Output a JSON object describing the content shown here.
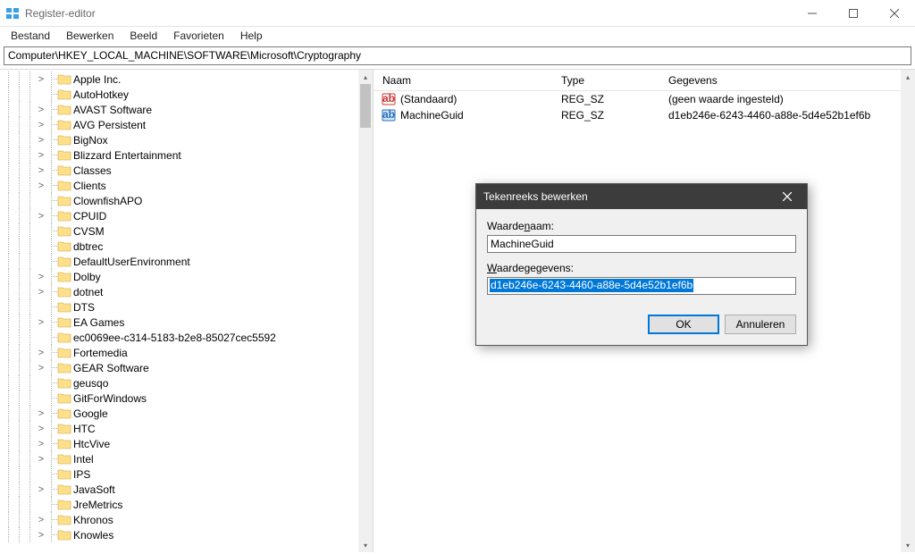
{
  "title": "Register-editor",
  "menu": {
    "bestand": "Bestand",
    "bewerken": "Bewerken",
    "beeld": "Beeld",
    "favorieten": "Favorieten",
    "help": "Help"
  },
  "address": "Computer\\HKEY_LOCAL_MACHINE\\SOFTWARE\\Microsoft\\Cryptography",
  "tree": [
    {
      "label": "Apple Inc.",
      "expand": ">"
    },
    {
      "label": "AutoHotkey",
      "expand": ""
    },
    {
      "label": "AVAST Software",
      "expand": ">"
    },
    {
      "label": "AVG Persistent",
      "expand": ">"
    },
    {
      "label": "BigNox",
      "expand": ">"
    },
    {
      "label": "Blizzard Entertainment",
      "expand": ">"
    },
    {
      "label": "Classes",
      "expand": ">"
    },
    {
      "label": "Clients",
      "expand": ">"
    },
    {
      "label": "ClownfishAPO",
      "expand": ""
    },
    {
      "label": "CPUID",
      "expand": ">"
    },
    {
      "label": "CVSM",
      "expand": ""
    },
    {
      "label": "dbtrec",
      "expand": ""
    },
    {
      "label": "DefaultUserEnvironment",
      "expand": ""
    },
    {
      "label": "Dolby",
      "expand": ">"
    },
    {
      "label": "dotnet",
      "expand": ">"
    },
    {
      "label": "DTS",
      "expand": ""
    },
    {
      "label": "EA Games",
      "expand": ">"
    },
    {
      "label": "ec0069ee-c314-5183-b2e8-85027cec5592",
      "expand": ""
    },
    {
      "label": "Fortemedia",
      "expand": ">"
    },
    {
      "label": "GEAR Software",
      "expand": ">"
    },
    {
      "label": "geusqo",
      "expand": ""
    },
    {
      "label": "GitForWindows",
      "expand": ""
    },
    {
      "label": "Google",
      "expand": ">"
    },
    {
      "label": "HTC",
      "expand": ">"
    },
    {
      "label": "HtcVive",
      "expand": ">"
    },
    {
      "label": "Intel",
      "expand": ">"
    },
    {
      "label": "IPS",
      "expand": ""
    },
    {
      "label": "JavaSoft",
      "expand": ">"
    },
    {
      "label": "JreMetrics",
      "expand": ""
    },
    {
      "label": "Khronos",
      "expand": ">"
    },
    {
      "label": "Knowles",
      "expand": ">"
    }
  ],
  "values": {
    "headers": {
      "naam": "Naam",
      "type": "Type",
      "gegevens": "Gegevens"
    },
    "rows": [
      {
        "icon": "ab-red",
        "name": "(Standaard)",
        "type": "REG_SZ",
        "data": "(geen waarde ingesteld)"
      },
      {
        "icon": "ab-blue",
        "name": "MachineGuid",
        "type": "REG_SZ",
        "data": "d1eb246e-6243-4460-a88e-5d4e52b1ef6b"
      }
    ]
  },
  "dialog": {
    "title": "Tekenreeks bewerken",
    "name_label_pre": "Waarde",
    "name_label_ul": "n",
    "name_label_post": "aam:",
    "name_value": "MachineGuid",
    "data_label_ul": "W",
    "data_label_post": "aardegegevens:",
    "data_value": "d1eb246e-6243-4460-a88e-5d4e52b1ef6b",
    "ok": "OK",
    "cancel": "Annuleren"
  }
}
